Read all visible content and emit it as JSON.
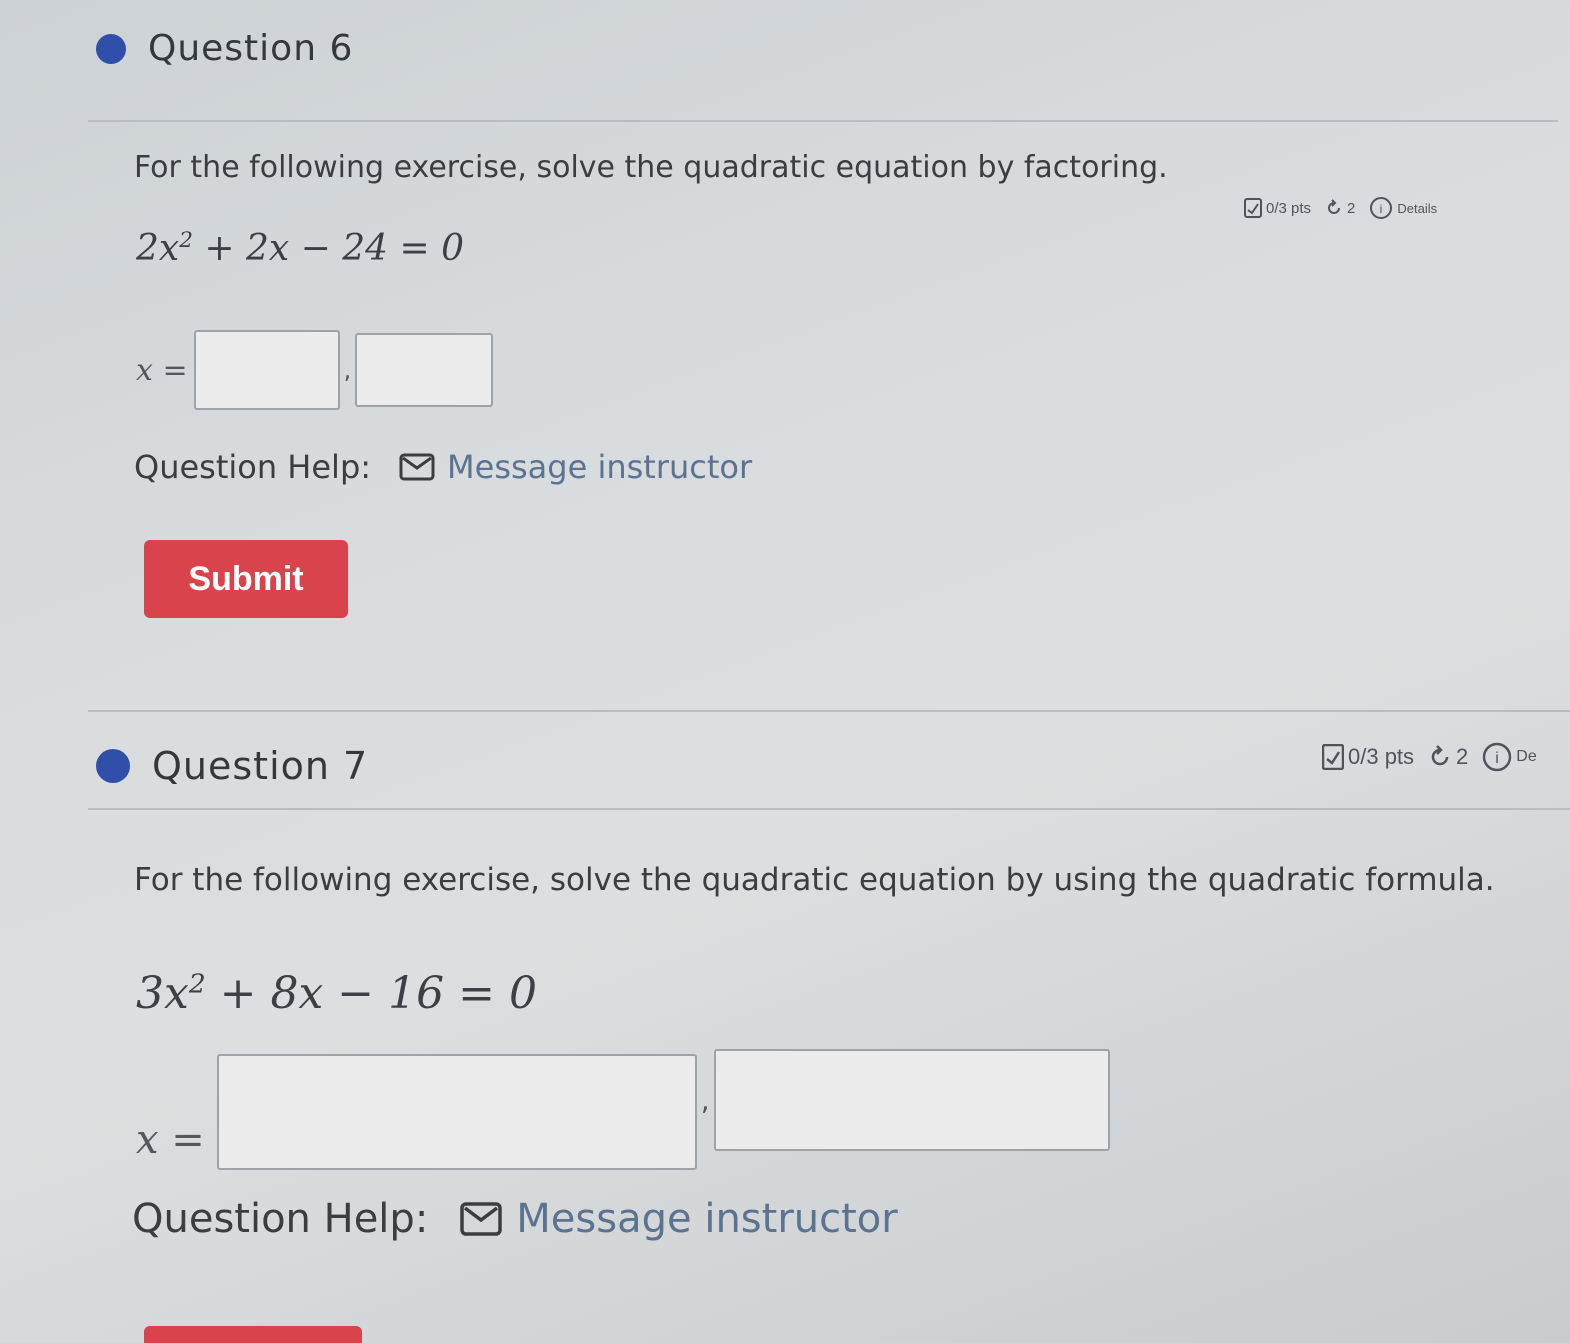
{
  "question6": {
    "title": "Question 6",
    "meta": {
      "points": "0/3 pts",
      "attempts": "2",
      "details": "Details"
    },
    "prompt": "For the following exercise, solve the quadratic equation by factoring.",
    "equation": {
      "coef_a": "2",
      "var": "x",
      "exponent": "2",
      "rest": " + 2x − 24 = 0"
    },
    "answer": {
      "label": "x =",
      "separator": ","
    },
    "help_label": "Question Help:",
    "message_link": "Message instructor",
    "submit_label": "Submit"
  },
  "question7": {
    "title": "Question 7",
    "meta": {
      "points": "0/3 pts",
      "attempts": "2",
      "details": "De"
    },
    "prompt": "For the following exercise, solve the quadratic equation by using the quadratic formula.",
    "equation": {
      "coef_a": "3",
      "var": "x",
      "exponent": "2",
      "rest": " + 8x − 16 = 0"
    },
    "answer": {
      "label": "x =",
      "separator": ","
    },
    "help_label": "Question Help:",
    "message_link": "Message instructor"
  },
  "colors": {
    "accent_dot": "#2f4fa8",
    "submit_bg": "#d9434b",
    "link": "#5b7390"
  }
}
